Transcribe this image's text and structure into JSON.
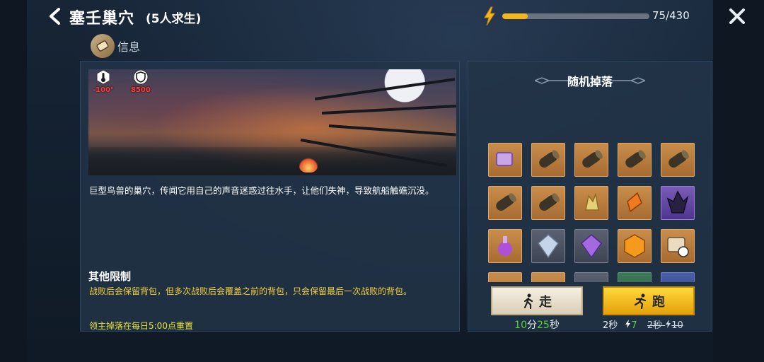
{
  "header": {
    "title": "塞壬巢穴",
    "subtitle": "(5人求生)",
    "energy_text": "75/430",
    "energy_fraction": 0.174
  },
  "info_tab": {
    "label": "信息"
  },
  "stats": {
    "temperature": "-100°",
    "defense": "8500"
  },
  "description": "巨型鸟兽的巢穴，传闻它用自己的声音迷惑过往水手，让他们失神，导致航船触礁沉没。",
  "limits": {
    "title": "其他限制",
    "text": "战败后会保留背包，但多次战败后会覆盖之前的背包，只会保留最后一次战败的背包。",
    "reset": "领主掉落在每日5:00点重置"
  },
  "drops": {
    "title": "随机掉落",
    "items": [
      {
        "icon": "purple-scroll-icon",
        "rarity": "orange"
      },
      {
        "icon": "wood-log-icon",
        "rarity": "orange"
      },
      {
        "icon": "wood-log-icon",
        "rarity": "orange"
      },
      {
        "icon": "wood-log-icon",
        "rarity": "orange"
      },
      {
        "icon": "wood-log-icon",
        "rarity": "orange"
      },
      {
        "icon": "wood-log-icon",
        "rarity": "orange"
      },
      {
        "icon": "wood-log-icon",
        "rarity": "orange"
      },
      {
        "icon": "gold-crystal-icon",
        "rarity": "orange"
      },
      {
        "icon": "amber-shard-icon",
        "rarity": "orange"
      },
      {
        "icon": "dark-crystal-icon",
        "rarity": "purple"
      },
      {
        "icon": "purple-potion-icon",
        "rarity": "orange"
      },
      {
        "icon": "silver-gem-icon",
        "rarity": "gray"
      },
      {
        "icon": "purple-gem-icon",
        "rarity": "gray"
      },
      {
        "icon": "amber-gem-icon",
        "rarity": "orange"
      },
      {
        "icon": "scroll-clock-icon",
        "rarity": "orange"
      },
      {
        "icon": "item-icon",
        "rarity": "orange"
      },
      {
        "icon": "item-icon",
        "rarity": "orange"
      },
      {
        "icon": "item-icon",
        "rarity": "gray"
      },
      {
        "icon": "item-icon",
        "rarity": "green"
      },
      {
        "icon": "item-icon",
        "rarity": "blue"
      }
    ]
  },
  "walk": {
    "label": "走",
    "time_min": "10",
    "min_unit": "分",
    "time_sec": "25",
    "sec_unit": "秒"
  },
  "run": {
    "label": "跑",
    "time": "2秒",
    "cost": "7",
    "old_time": "2秒",
    "old_cost": "10"
  },
  "colors": {
    "energy": "#f4b61d",
    "accent_yellow": "#f4d13a",
    "green": "#57d13c",
    "danger": "#ff3a3a"
  }
}
